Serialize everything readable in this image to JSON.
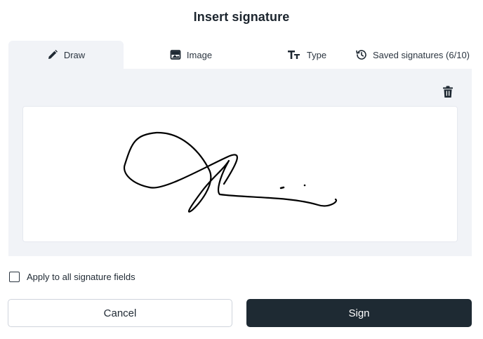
{
  "dialog": {
    "title": "Insert signature"
  },
  "tabs": [
    {
      "label": "Draw",
      "icon": "pencil-icon",
      "active": true
    },
    {
      "label": "Image",
      "icon": "image-icon",
      "active": false
    },
    {
      "label": "Type",
      "icon": "text-type-icon",
      "active": false
    },
    {
      "label": "Saved signatures (6/10)",
      "icon": "history-icon",
      "active": false
    }
  ],
  "apply_all": {
    "label": "Apply to all signature fields",
    "checked": false
  },
  "buttons": {
    "cancel": "Cancel",
    "sign": "Sign"
  },
  "colors": {
    "primary": "#1e2a33",
    "panel_bg": "#f1f3f7",
    "ink": "#000000"
  }
}
